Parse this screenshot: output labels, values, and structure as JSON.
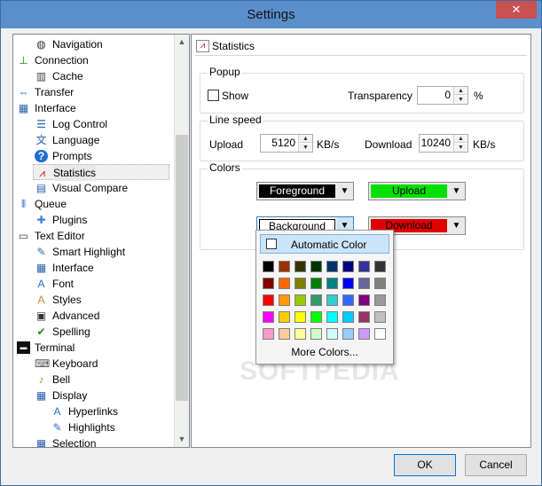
{
  "window": {
    "title": "Settings",
    "close_label": "✕"
  },
  "tree": {
    "items": [
      {
        "label": "Navigation",
        "level": 2,
        "icon": "compass-icon",
        "glyph": "◍",
        "color": "#333"
      },
      {
        "label": "Connection",
        "level": 1,
        "icon": "connection-icon",
        "glyph": "⊥",
        "color": "#1a8a1a"
      },
      {
        "label": "Cache",
        "level": 2,
        "icon": "cache-icon",
        "glyph": "▥",
        "color": "#444"
      },
      {
        "label": "Transfer",
        "level": 1,
        "icon": "transfer-icon",
        "glyph": "⇔",
        "color": "#1f6fd0"
      },
      {
        "label": "Interface",
        "level": 1,
        "icon": "interface-icon",
        "glyph": "▦",
        "color": "#2b5fb0"
      },
      {
        "label": "Log Control",
        "level": 2,
        "icon": "log-icon",
        "glyph": "☰",
        "color": "#2b5fb0"
      },
      {
        "label": "Language",
        "level": 2,
        "icon": "language-icon",
        "glyph": "文",
        "color": "#2b5fb0"
      },
      {
        "label": "Prompts",
        "level": 2,
        "icon": "prompts-icon",
        "glyph": "?",
        "color": "#fff"
      },
      {
        "label": "Statistics",
        "level": 2,
        "icon": "statistics-icon",
        "glyph": "⩘",
        "color": "#c00"
      },
      {
        "label": "Visual Compare",
        "level": 2,
        "icon": "compare-icon",
        "glyph": "▤",
        "color": "#2b5fb0"
      },
      {
        "label": "Queue",
        "level": 1,
        "icon": "queue-icon",
        "glyph": "⫴",
        "color": "#1f6fd0"
      },
      {
        "label": "Plugins",
        "level": 2,
        "icon": "plugins-icon",
        "glyph": "✚",
        "color": "#3b7fd9"
      },
      {
        "label": "Text Editor",
        "level": 1,
        "icon": "text-editor-icon",
        "glyph": "▭",
        "color": "#444"
      },
      {
        "label": "Smart Highlight",
        "level": 2,
        "icon": "highlight-icon",
        "glyph": "✎",
        "color": "#1f6fd0"
      },
      {
        "label": "Interface",
        "level": 2,
        "icon": "interface-icon",
        "glyph": "▦",
        "color": "#2b5fb0"
      },
      {
        "label": "Font",
        "level": 2,
        "icon": "font-icon",
        "glyph": "A",
        "color": "#1f6fd0"
      },
      {
        "label": "Styles",
        "level": 2,
        "icon": "styles-icon",
        "glyph": "A",
        "color": "#d08a1f"
      },
      {
        "label": "Advanced",
        "level": 2,
        "icon": "advanced-icon",
        "glyph": "▣",
        "color": "#333"
      },
      {
        "label": "Spelling",
        "level": 2,
        "icon": "spelling-icon",
        "glyph": "✔",
        "color": "#1a8a1a"
      },
      {
        "label": "Terminal",
        "level": 1,
        "icon": "terminal-icon",
        "glyph": "▬",
        "color": "#111"
      },
      {
        "label": "Keyboard",
        "level": 2,
        "icon": "keyboard-icon",
        "glyph": "⌨",
        "color": "#555"
      },
      {
        "label": "Bell",
        "level": 2,
        "icon": "bell-icon",
        "glyph": "♪",
        "color": "#c08020"
      },
      {
        "label": "Display",
        "level": 2,
        "icon": "display-icon",
        "glyph": "▦",
        "color": "#2b5fb0"
      },
      {
        "label": "Hyperlinks",
        "level": 3,
        "icon": "hyperlinks-icon",
        "glyph": "A",
        "color": "#1f6fd0"
      },
      {
        "label": "Highlights",
        "level": 3,
        "icon": "highlights-icon",
        "glyph": "✎",
        "color": "#1f6fd0"
      },
      {
        "label": "Selection",
        "level": 2,
        "icon": "selection-icon",
        "glyph": "▦",
        "color": "#2b5fb0"
      }
    ],
    "selected_index": 8
  },
  "panel": {
    "title": "Statistics",
    "popup_group": {
      "title": "Popup",
      "show_label": "Show",
      "show_checked": false,
      "transparency_label": "Transparency",
      "transparency_value": "0",
      "percent_label": "%"
    },
    "line_speed_group": {
      "title": "Line speed",
      "upload_label": "Upload",
      "upload_value": "5120",
      "upload_unit": "KB/s",
      "download_label": "Download",
      "download_value": "10240",
      "download_unit": "KB/s"
    },
    "colors_group": {
      "title": "Colors",
      "foreground": {
        "label": "Foreground",
        "bg": "#000000",
        "fg": "#ffffff"
      },
      "upload": {
        "label": "Upload",
        "bg": "#00e000",
        "fg": "#000000"
      },
      "background": {
        "label": "Background",
        "bg": "#ffffff",
        "fg": "#000000"
      },
      "download": {
        "label": "Download",
        "bg": "#e00000",
        "fg": "#000000"
      }
    }
  },
  "color_popup": {
    "automatic_label": "Automatic Color",
    "more_colors_label": "More Colors...",
    "rows": [
      [
        "#000000",
        "#993300",
        "#333300",
        "#003300",
        "#003366",
        "#000080",
        "#333399",
        "#333333"
      ],
      [
        "#800000",
        "#ff6600",
        "#808000",
        "#008000",
        "#008080",
        "#0000ff",
        "#666699",
        "#808080"
      ],
      [
        "#ff0000",
        "#ff9900",
        "#99cc00",
        "#339966",
        "#33cccc",
        "#3366ff",
        "#800080",
        "#999999"
      ],
      [
        "#ff00ff",
        "#ffcc00",
        "#ffff00",
        "#00ff00",
        "#00ffff",
        "#00ccff",
        "#993366",
        "#c0c0c0"
      ],
      [
        "#ff99cc",
        "#ffcc99",
        "#ffff99",
        "#ccffcc",
        "#ccffff",
        "#99ccff",
        "#cc99ff",
        "#ffffff"
      ]
    ]
  },
  "watermark": "SOFTPEDIA",
  "buttons": {
    "ok_label": "OK",
    "cancel_label": "Cancel"
  }
}
